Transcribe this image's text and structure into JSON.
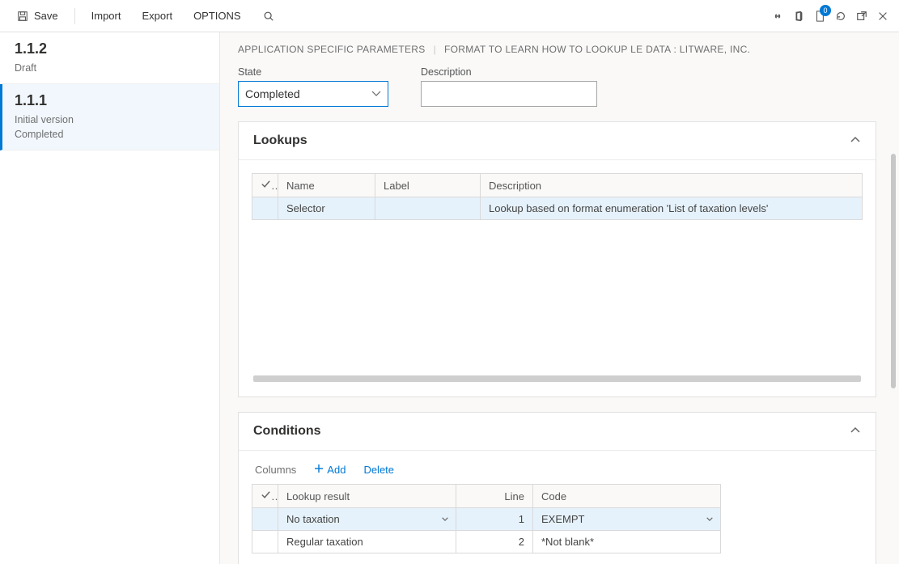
{
  "toolbar": {
    "save": "Save",
    "import": "Import",
    "export": "Export",
    "options": "OPTIONS",
    "badge_count": "0"
  },
  "sidebar": {
    "items": [
      {
        "version": "1.1.2",
        "meta1": "Draft",
        "meta2": ""
      },
      {
        "version": "1.1.1",
        "meta1": "Initial version",
        "meta2": "Completed"
      }
    ]
  },
  "breadcrumb": {
    "part1": "APPLICATION SPECIFIC PARAMETERS",
    "part2": "FORMAT TO LEARN HOW TO LOOKUP LE DATA : LITWARE, INC."
  },
  "fields": {
    "state_label": "State",
    "state_value": "Completed",
    "description_label": "Description",
    "description_value": ""
  },
  "lookups": {
    "title": "Lookups",
    "cols": {
      "name": "Name",
      "label": "Label",
      "description": "Description"
    },
    "rows": [
      {
        "name": "Selector",
        "label": "",
        "description": "Lookup based on format enumeration 'List of taxation levels'"
      }
    ]
  },
  "conditions": {
    "title": "Conditions",
    "toolbar": {
      "columns": "Columns",
      "add": "Add",
      "delete": "Delete"
    },
    "cols": {
      "result": "Lookup result",
      "line": "Line",
      "code": "Code"
    },
    "rows": [
      {
        "result": "No taxation",
        "line": "1",
        "code": "EXEMPT"
      },
      {
        "result": "Regular taxation",
        "line": "2",
        "code": "*Not blank*"
      }
    ]
  }
}
